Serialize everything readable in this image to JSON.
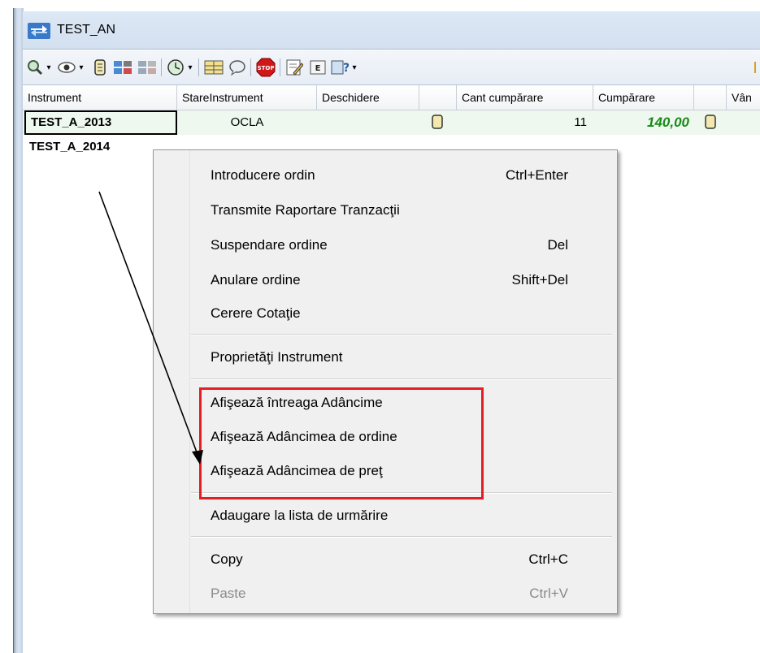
{
  "window": {
    "title": "TEST_AN"
  },
  "toolbar": {
    "icons": [
      "search-icon",
      "eye-icon",
      "scroll-icon",
      "order-book-icon",
      "order-book-disabled-icon",
      "clock-icon",
      "grid-icon",
      "comment-icon",
      "stop-icon",
      "edit-icon",
      "e-icon",
      "help-icon"
    ]
  },
  "grid": {
    "columns": [
      "Instrument",
      "StareInstrument",
      "Deschidere",
      "",
      "Cant cumpărare",
      "Cumpărare",
      "",
      "Vân"
    ],
    "rows": [
      {
        "instrument": "TEST_A_2013",
        "state": "OCLA",
        "buy_qty": "11",
        "buy_price": "140,00"
      },
      {
        "instrument": "TEST_A_2014",
        "state": "",
        "buy_qty": "",
        "buy_price": ""
      }
    ]
  },
  "context_menu": {
    "items": [
      {
        "label": "Introducere ordin",
        "shortcut": "Ctrl+Enter"
      },
      {
        "label": "Transmite Raportare Tranzacţii",
        "shortcut": ""
      },
      {
        "label": "Suspendare ordine",
        "shortcut": "Del"
      },
      {
        "label": "Anulare ordine",
        "shortcut": "Shift+Del"
      },
      {
        "label": "Cerere Cotaţie",
        "shortcut": ""
      },
      {
        "label": "Proprietăţi Instrument",
        "shortcut": ""
      },
      {
        "label": "Afişează întreaga Adâncime",
        "shortcut": ""
      },
      {
        "label": "Afişează Adâncimea de ordine",
        "shortcut": ""
      },
      {
        "label": "Afişează Adâncimea de preţ",
        "shortcut": ""
      },
      {
        "label": "Adaugare la lista de urmărire",
        "shortcut": ""
      },
      {
        "label": "Copy",
        "shortcut": "Ctrl+C"
      },
      {
        "label": "Paste",
        "shortcut": "Ctrl+V",
        "disabled": true
      }
    ]
  },
  "colors": {
    "highlight": "#e31e24",
    "buy_price": "#1a8a1a",
    "menu_bg": "#f0f0f0"
  }
}
